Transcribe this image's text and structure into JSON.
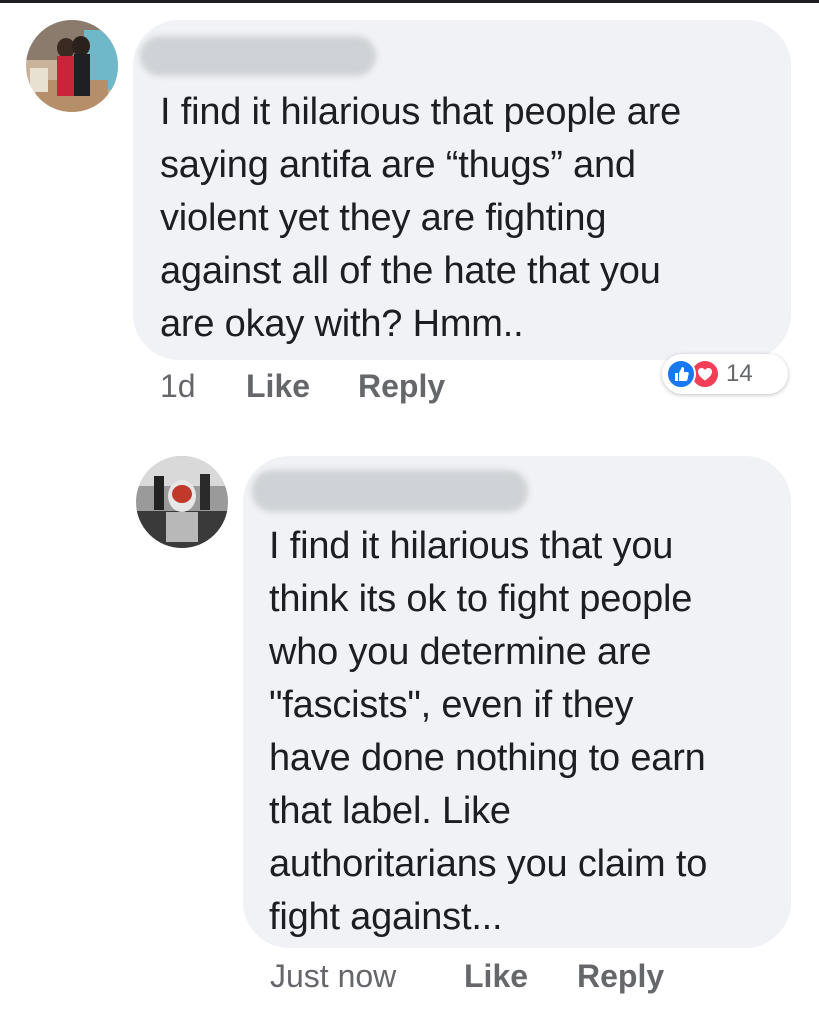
{
  "comments": [
    {
      "text": "I find it hilarious that people are\nsaying antifa are “thugs” and\nviolent yet they are fighting\nagainst all of the hate that you\nare okay with? Hmm..",
      "time": "1d",
      "like_label": "Like",
      "reply_label": "Reply",
      "reaction_count": "14",
      "reaction_icons": [
        "like-icon",
        "love-icon"
      ]
    },
    {
      "text": "I find it hilarious that you\nthink its ok to fight people\nwho you determine are\n\"fascists\", even if they\nhave done nothing to earn\nthat label. Like\nauthoritarians you claim to\nfight against...",
      "time": "Just now",
      "like_label": "Like",
      "reply_label": "Reply"
    }
  ],
  "colors": {
    "bubble": "#f0f2f5",
    "meta_text": "#65676b",
    "like_blue": "#1877f2",
    "love_red": "#f33e58"
  }
}
